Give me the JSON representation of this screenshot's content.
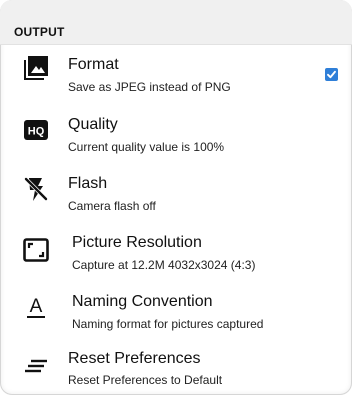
{
  "section": {
    "title": "OUTPUT"
  },
  "preferences": [
    {
      "title": "Format",
      "summary": "Save as JPEG instead of PNG",
      "icon": "image-icon",
      "checked": true
    },
    {
      "title": "Quality",
      "summary": "Current quality value is 100%",
      "icon": "hq-icon",
      "badge": "HQ"
    },
    {
      "title": "Flash",
      "summary": "Camera flash off",
      "icon": "flash-off-icon"
    },
    {
      "title": "Picture Resolution",
      "summary": "Capture at 12.2M 4032x3024 (4:3)",
      "icon": "crop-free-icon"
    },
    {
      "title": "Naming Convention",
      "summary": "Naming format for pictures captured",
      "icon": "text-format-icon",
      "glyph": "A"
    },
    {
      "title": "Reset Preferences",
      "summary": "Reset Preferences to Default",
      "icon": "sort-icon"
    }
  ],
  "colors": {
    "accent": "#2f7fd8",
    "header_bg": "#f0f0f0"
  }
}
